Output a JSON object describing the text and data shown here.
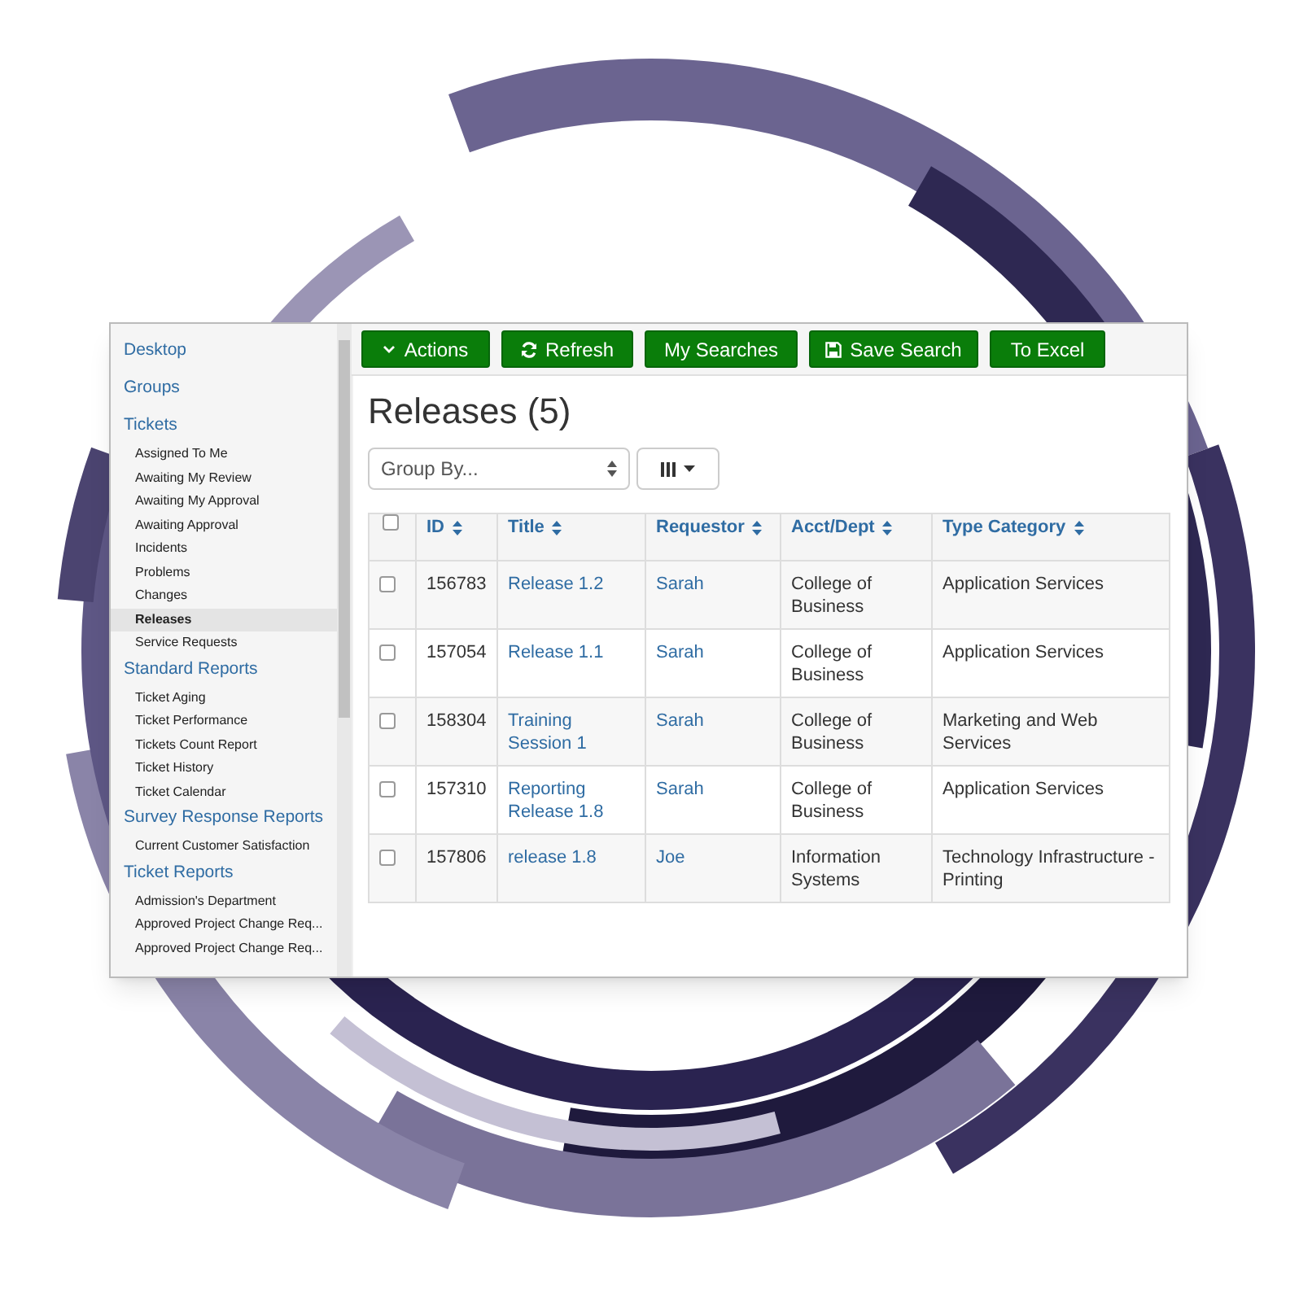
{
  "sidebar": {
    "sections": [
      {
        "title": "Desktop",
        "selected": false
      },
      {
        "title": "Groups",
        "selected": false
      },
      {
        "title": "Tickets",
        "selected": false,
        "items": [
          {
            "label": "Assigned To Me",
            "selected": false
          },
          {
            "label": "Awaiting My Review",
            "selected": false
          },
          {
            "label": "Awaiting My Approval",
            "selected": false
          },
          {
            "label": "Awaiting Approval",
            "selected": false
          },
          {
            "label": "Incidents",
            "selected": false
          },
          {
            "label": "Problems",
            "selected": false
          },
          {
            "label": "Changes",
            "selected": false
          },
          {
            "label": "Releases",
            "selected": true
          },
          {
            "label": "Service Requests",
            "selected": false
          }
        ]
      },
      {
        "title": "Standard Reports",
        "selected": false,
        "items": [
          {
            "label": "Ticket Aging",
            "selected": false
          },
          {
            "label": "Ticket Performance",
            "selected": false
          },
          {
            "label": "Tickets Count Report",
            "selected": false
          },
          {
            "label": "Ticket History",
            "selected": false
          },
          {
            "label": "Ticket Calendar",
            "selected": false
          }
        ]
      },
      {
        "title": "Survey Response Reports",
        "selected": false,
        "items": [
          {
            "label": "Current Customer Satisfaction",
            "selected": false
          }
        ]
      },
      {
        "title": "Ticket Reports",
        "selected": false,
        "items": [
          {
            "label": "Admission's Department",
            "selected": false
          },
          {
            "label": "Approved Project Change Req...",
            "selected": false
          },
          {
            "label": "Approved Project Change Req...",
            "selected": false
          }
        ]
      }
    ]
  },
  "toolbar": [
    {
      "label": "Actions"
    },
    {
      "label": "Refresh"
    },
    {
      "label": "My Searches"
    },
    {
      "label": "Save Search"
    },
    {
      "label": "To Excel"
    }
  ],
  "title": "Releases (5)",
  "group_by": {
    "placeholder": "Group By..."
  },
  "table": {
    "all_checked": false,
    "columns": [
      "ID",
      "Title",
      "Requestor",
      "Acct/Dept",
      "Type Category"
    ],
    "rows": [
      {
        "checked": false,
        "cells": [
          "156783",
          "Release 1.2",
          "Sarah",
          "College of Business",
          "Application Services"
        ]
      },
      {
        "checked": false,
        "cells": [
          "157054",
          "Release 1.1",
          "Sarah",
          "College of Business",
          "Application Services"
        ]
      },
      {
        "checked": false,
        "cells": [
          "158304",
          "Training Session 1",
          "Sarah",
          "College of Business",
          "Marketing and Web Services"
        ]
      },
      {
        "checked": false,
        "cells": [
          "157310",
          "Reporting Release 1.8",
          "Sarah",
          "College of Business",
          "Application Services"
        ]
      },
      {
        "checked": false,
        "cells": [
          "157806",
          "release 1.8",
          "Joe",
          "Information Systems",
          "Technology Infrastructure - Printing"
        ]
      }
    ]
  }
}
